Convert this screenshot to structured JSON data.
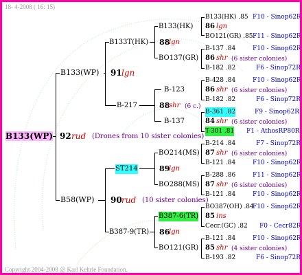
{
  "header": {
    "date_stamp": "18- 4-2008 ( 16: 15)"
  },
  "footer": {
    "copyright": "Copyright 2004-2008 @ Karl Kehrle Foundation."
  },
  "root": {
    "name": "B133(WP)",
    "year": "92",
    "breeder": "rud",
    "note": "(Drones from 10 sister colonies)"
  },
  "gen1": [
    {
      "name": "B133(WP)",
      "year": "91",
      "breeder": "lgn",
      "note": ""
    },
    {
      "name": "B58(WP)",
      "year": "90",
      "breeder": "rud",
      "note": "(10 sister colonies)"
    }
  ],
  "gen2": [
    {
      "name": "B133T(HK)",
      "year": "88",
      "breeder": "lgn",
      "note": ""
    },
    {
      "name": "B-217",
      "year": "88",
      "breeder": "shr",
      "note": "(6 c.)"
    },
    {
      "name": "ST214",
      "year": "89",
      "breeder": "lgn",
      "note": ""
    },
    {
      "name": "B387-9(TR)",
      "year": "86",
      "breeder": "lgn",
      "note": ""
    }
  ],
  "gen3": [
    {
      "name": "B133(HK)",
      "year": "86",
      "breeder": "lgn",
      "note": ""
    },
    {
      "name": "BO137(GR)",
      "year": "86",
      "breeder": "shr",
      "note": "(6 sister colonies)"
    },
    {
      "name": "B-123",
      "year": "",
      "breeder": "",
      "note": ""
    },
    {
      "name": "B-137",
      "year": "",
      "breeder": "",
      "note": ""
    },
    {
      "name": "BO214(MS)",
      "year": "87",
      "breeder": "shr",
      "note": "(6 sister colonies)"
    },
    {
      "name": "BO288(MS)",
      "year": "87",
      "breeder": "shr",
      "note": "(6 sister colonies)"
    },
    {
      "name": "B387-6(TR)",
      "year": "85",
      "breeder": "ins",
      "note": ""
    },
    {
      "name": "BO121(GR)",
      "year": "85",
      "breeder": "shr",
      "note": "(4 sister colonies)"
    }
  ],
  "gen4": [
    {
      "name": "B133(HK) .85",
      "code": "F10 - Sinop62R"
    },
    {
      "name": "BO121(GR) .85",
      "code": "F11 - Sinop62R"
    },
    {
      "name": "B-137 .84",
      "code": "F10 - Sinop62R"
    },
    {
      "name": "B-182 .82",
      "code": "F6 - Sinop72R"
    },
    {
      "name": "B-428 .84",
      "code": "F10 - Sinop62R"
    },
    {
      "name": "B-182 .82",
      "code": "F6 - Sinop72R"
    },
    {
      "name": "B-361 .82",
      "code": "F9 - Sinop62R"
    },
    {
      "name": "T-301 .81",
      "code": "F1 - AthosRP80R"
    },
    {
      "name": "B-214 .84",
      "code": "F7 - Sinop72R"
    },
    {
      "name": "B-121 .84",
      "code": "F10 - Sinop62R"
    },
    {
      "name": "B-288 .86",
      "code": "F11 - Sinop62R"
    },
    {
      "name": "B-121 .84",
      "code": "F10 - Sinop62R"
    },
    {
      "name": "BO387(OH) .84",
      "code": "F10 - Sinop62R"
    },
    {
      "name": "Cecr.(GC) .82",
      "code": "F0 - Cecr82R"
    },
    {
      "name": "B-121 .84",
      "code": "F10 - Sinop62R"
    },
    {
      "name": "B-193 .82",
      "code": "F6 - Sinop72R"
    }
  ],
  "gen4_mid": [
    {
      "year": "86",
      "breeder": "lgn",
      "note": ""
    },
    {
      "year": "86",
      "breeder": "shr",
      "note": "(6 sister colonies)"
    },
    {
      "year": "86",
      "breeder": "shr",
      "note": "(6 sister colonies)"
    },
    {
      "year": "84",
      "breeder": "shr",
      "note": "(6 sister colonies)"
    },
    {
      "year": "87",
      "breeder": "shr",
      "note": "(6 sister colonies)"
    },
    {
      "year": "87",
      "breeder": "shr",
      "note": "(6 sister colonies)"
    },
    {
      "year": "85",
      "breeder": "ins",
      "note": ""
    },
    {
      "year": "85",
      "breeder": "shr",
      "note": "(4 sister colonies)"
    }
  ],
  "colors": {
    "border": "#ff00aa",
    "highlight_root": "#ffb5ff",
    "highlight_cyan": "#33ffff",
    "highlight_green": "#33ee44",
    "red": "#d10000",
    "blue": "#0000cc",
    "purple": "#70008f"
  }
}
